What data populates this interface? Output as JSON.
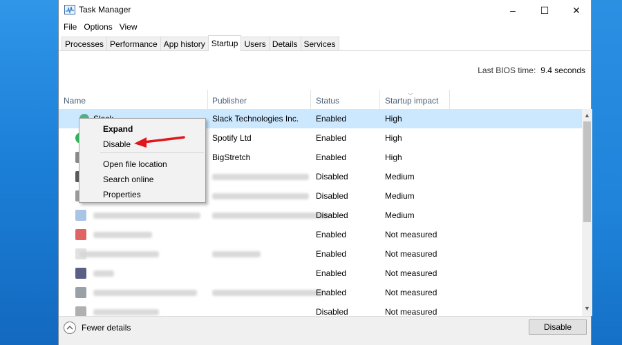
{
  "window": {
    "title": "Task Manager",
    "controls": {
      "minimize": "–",
      "maximize": "☐",
      "close": "✕"
    }
  },
  "menu": [
    "File",
    "Options",
    "View"
  ],
  "tabs": [
    {
      "label": "Processes",
      "active": false
    },
    {
      "label": "Performance",
      "active": false
    },
    {
      "label": "App history",
      "active": false
    },
    {
      "label": "Startup",
      "active": true
    },
    {
      "label": "Users",
      "active": false
    },
    {
      "label": "Details",
      "active": false
    },
    {
      "label": "Services",
      "active": false
    }
  ],
  "bios": {
    "label": "Last BIOS time:",
    "value": "9.4 seconds"
  },
  "columns": {
    "name": "Name",
    "publisher": "Publisher",
    "status": "Status",
    "impact": "Startup impact"
  },
  "rows": [
    {
      "name": "Slack",
      "publisher": "Slack Technologies Inc.",
      "status": "Enabled",
      "impact": "High",
      "icon_color": "#4fb286",
      "selected": true
    },
    {
      "name": "",
      "publisher": "Spotify Ltd",
      "status": "Enabled",
      "impact": "High",
      "icon_color": "#2fb457"
    },
    {
      "name": "",
      "publisher": "BigStretch",
      "status": "Enabled",
      "impact": "High",
      "icon_color": "#8a8a8a"
    },
    {
      "name": "",
      "publisher": "",
      "status": "Disabled",
      "impact": "Medium",
      "icon_color": "#5a5a5a"
    },
    {
      "name": "",
      "publisher": "",
      "status": "Disabled",
      "impact": "Medium",
      "icon_color": "#9a9a9a"
    },
    {
      "name": "",
      "publisher": "",
      "status": "Disabled",
      "impact": "Medium",
      "icon_color": "#a9c4e4"
    },
    {
      "name": "",
      "publisher": "",
      "status": "Enabled",
      "impact": "Not measured",
      "icon_color": "#e06464"
    },
    {
      "name": "",
      "publisher": "",
      "status": "Enabled",
      "impact": "Not measured",
      "icon_color": "#e2e2e2"
    },
    {
      "name": "",
      "publisher": "",
      "status": "Enabled",
      "impact": "Not measured",
      "icon_color": "#5a5f86"
    },
    {
      "name": "",
      "publisher": "",
      "status": "Enabled",
      "impact": "Not measured",
      "icon_color": "#9aa0a8"
    },
    {
      "name": "",
      "publisher": "",
      "status": "Disabled",
      "impact": "Not measured",
      "icon_color": "#b0b0b0"
    }
  ],
  "context_menu": {
    "items": [
      "Expand",
      "Disable",
      "Open file location",
      "Search online",
      "Properties"
    ]
  },
  "footer": {
    "fewer_details": "Fewer details",
    "disable_button": "Disable"
  },
  "colors": {
    "selection": "#cce8ff",
    "header_text": "#4c607a",
    "arrow": "#e0161c"
  }
}
